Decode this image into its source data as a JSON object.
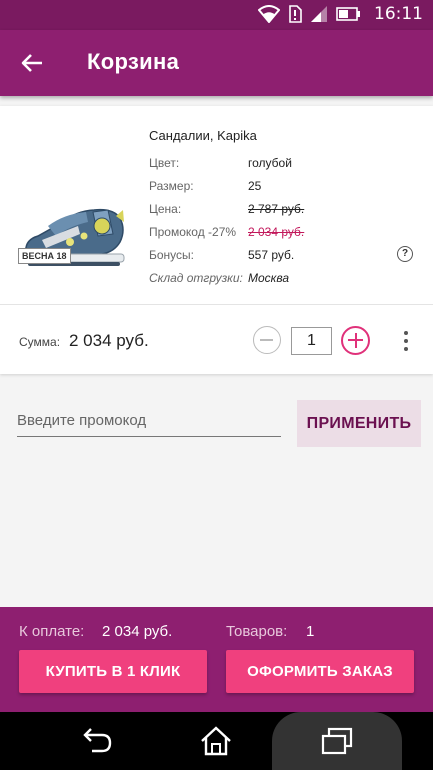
{
  "status_bar": {
    "time": "16:11"
  },
  "header": {
    "title": "Корзина"
  },
  "product": {
    "name": "Сандалии, Kapika",
    "badge": "ВЕСНА 18",
    "attributes": [
      {
        "label": "Цвет:",
        "value": "голубой"
      },
      {
        "label": "Размер:",
        "value": "25"
      },
      {
        "label": "Цена:",
        "value": "2 787 руб."
      },
      {
        "label": "Промокод -27%",
        "value": "2 034 руб."
      },
      {
        "label": "Бонусы:",
        "value": "557 руб."
      },
      {
        "label": "Склад отгрузки:",
        "value": "Москва"
      }
    ],
    "help": "?"
  },
  "summary": {
    "label": "Сумма:",
    "value": "2 034 руб.",
    "quantity": "1"
  },
  "promo": {
    "placeholder": "Введите промокод",
    "apply_label": "ПРИМЕНИТЬ"
  },
  "checkout": {
    "pay_label": "К оплате:",
    "pay_value": "2 034 руб.",
    "goods_label": "Товаров:",
    "goods_value": "1",
    "buy_label": "КУПИТЬ В 1 КЛИК",
    "order_label": "ОФОРМИТЬ ЗАКАЗ"
  },
  "colors": {
    "primary": "#8e1f70",
    "status": "#7a1a60",
    "accent": "#f0407e",
    "price_strike": "#c2185b"
  }
}
